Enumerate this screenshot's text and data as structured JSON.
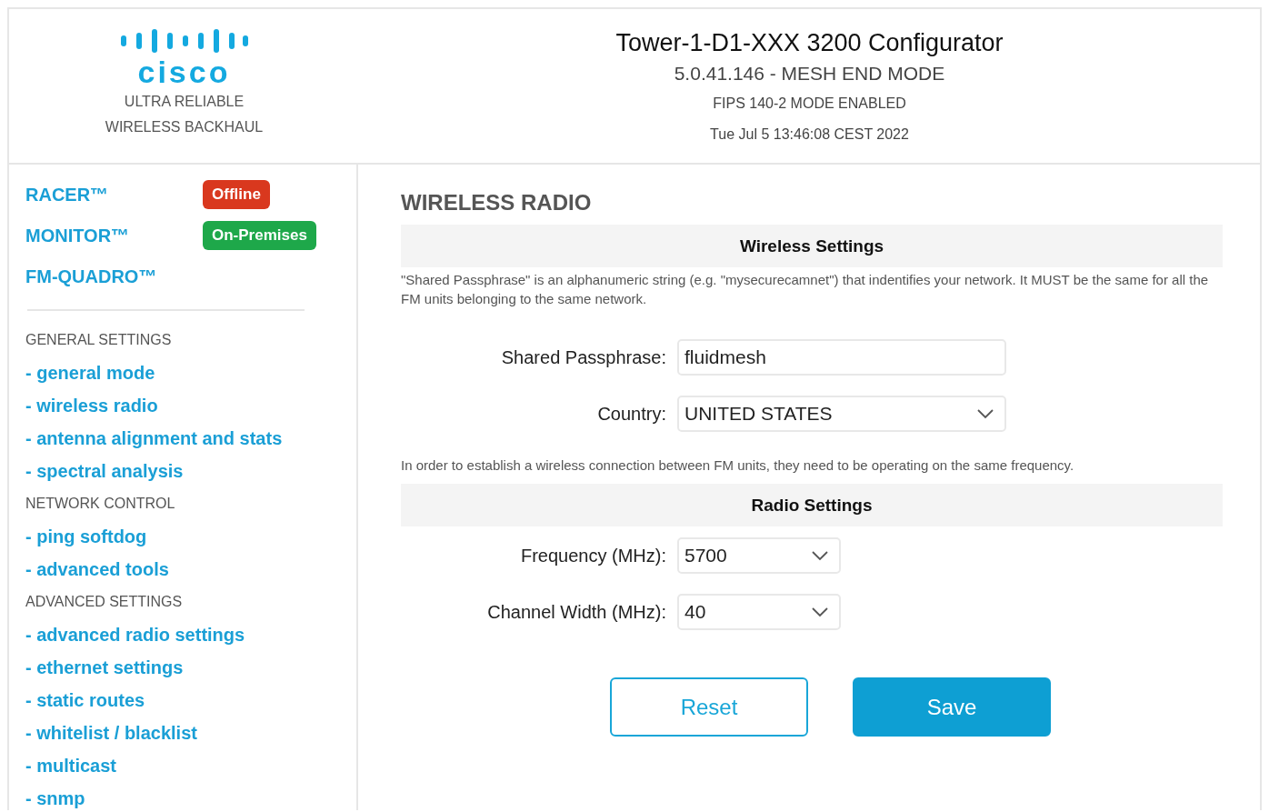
{
  "header": {
    "logo": "cisco",
    "tagline": [
      "ULTRA RELIABLE",
      "WIRELESS BACKHAUL"
    ],
    "title": "Tower-1-D1-XXX 3200 Configurator",
    "subtitle": "5.0.41.146 - MESH END MODE",
    "fips": "FIPS 140-2 MODE ENABLED",
    "datetime": "Tue Jul 5 13:46:08 CEST 2022"
  },
  "sidebar": {
    "products": [
      {
        "name": "RACER™",
        "badge": "Offline",
        "color": "#d9381e"
      },
      {
        "name": "MONITOR™",
        "badge": "On-Premises",
        "color": "#1ea84a"
      },
      {
        "name": "FM-QUADRO™"
      }
    ],
    "sections": [
      {
        "heading": "GENERAL SETTINGS",
        "items": [
          "- general mode",
          "- wireless radio",
          "- antenna alignment and stats",
          "- spectral analysis"
        ]
      },
      {
        "heading": "NETWORK CONTROL",
        "items": [
          "- ping softdog",
          "- advanced tools"
        ]
      },
      {
        "heading": "ADVANCED SETTINGS",
        "items": [
          "- advanced radio settings",
          "- ethernet settings",
          "- static routes",
          "- whitelist / blacklist",
          "- multicast",
          "- snmp"
        ]
      }
    ]
  },
  "main": {
    "title": "WIRELESS RADIO",
    "groups": [
      {
        "heading": "Wireless Settings",
        "note_above": "\"Shared Passphrase\" is an alphanumeric string (e.g. \"mysecurecamnet\") that indentifies your network. It MUST be the same for all the FM units belonging to the same network.",
        "fields": [
          {
            "kind": "text",
            "label": "Shared Passphrase:",
            "value": "fluidmesh"
          },
          {
            "kind": "select",
            "label": "Country:",
            "value": "UNITED STATES"
          }
        ],
        "note_below": "In order to establish a wireless connection between FM units, they need to be operating on the same frequency."
      },
      {
        "heading": "Radio Settings",
        "fields": [
          {
            "kind": "select",
            "label": "Frequency (MHz):",
            "value": "5700"
          },
          {
            "kind": "select",
            "label": "Channel Width (MHz):",
            "value": "40"
          }
        ]
      }
    ],
    "buttons": [
      {
        "label": "Reset",
        "kind": "secondary"
      },
      {
        "label": "Save",
        "kind": "primary"
      }
    ]
  }
}
